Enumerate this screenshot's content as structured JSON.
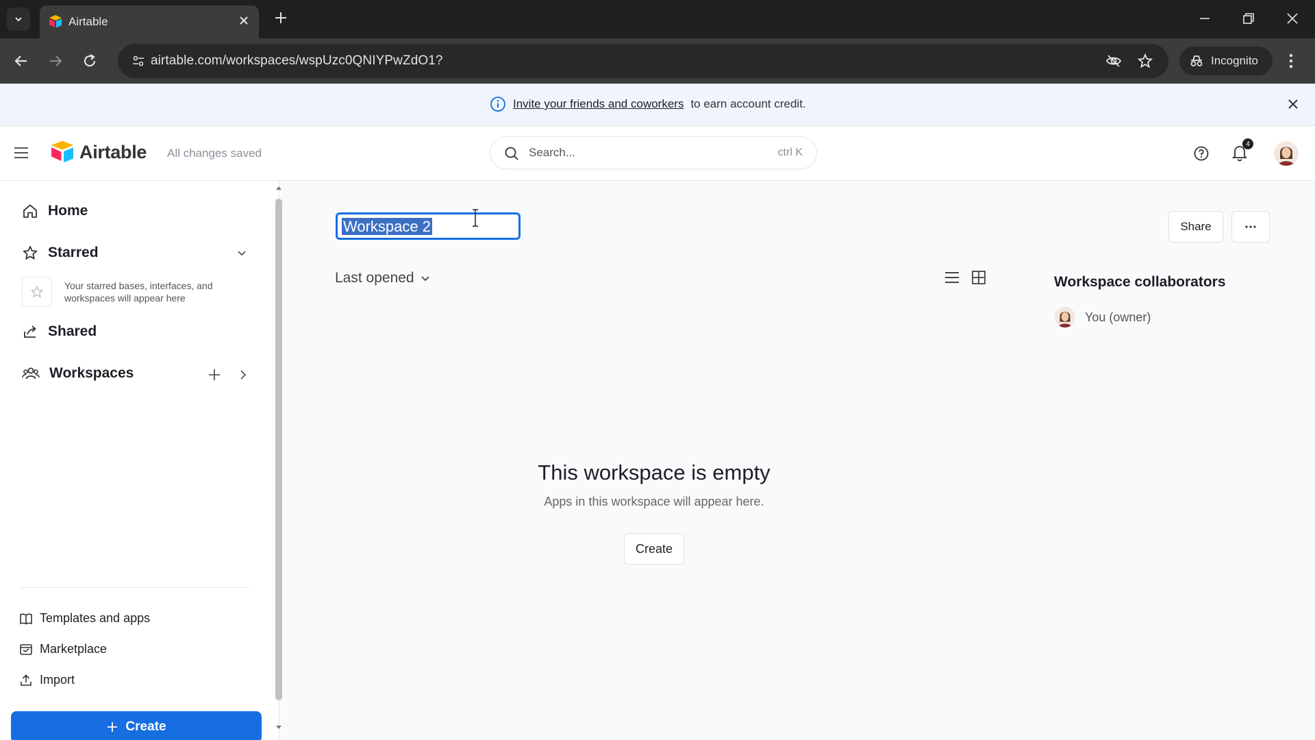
{
  "browser": {
    "tab_title": "Airtable",
    "url": "airtable.com/workspaces/wspUzc0QNIYPwZdO1?",
    "incognito_label": "Incognito"
  },
  "banner": {
    "link_text": "Invite your friends and coworkers",
    "rest_text": "to earn account credit."
  },
  "header": {
    "brand": "Airtable",
    "save_status": "All changes saved",
    "search_placeholder": "Search...",
    "search_shortcut": "ctrl K",
    "notification_count": "4"
  },
  "sidebar": {
    "home": "Home",
    "starred": "Starred",
    "starred_hint": "Your starred bases, interfaces, and workspaces will appear here",
    "shared": "Shared",
    "workspaces": "Workspaces",
    "templates": "Templates and apps",
    "marketplace": "Marketplace",
    "import": "Import",
    "create": "Create"
  },
  "main": {
    "workspace_name": "Workspace 2",
    "sort_label": "Last opened",
    "share": "Share",
    "collaborators_title": "Workspace collaborators",
    "owner_label": "You (owner)",
    "empty_title": "This workspace is empty",
    "empty_subtitle": "Apps in this workspace will appear here.",
    "empty_create": "Create"
  },
  "colors": {
    "accent": "#166ee1",
    "selection": "#3b6fc4",
    "chrome_dark": "#1f1f1f"
  }
}
